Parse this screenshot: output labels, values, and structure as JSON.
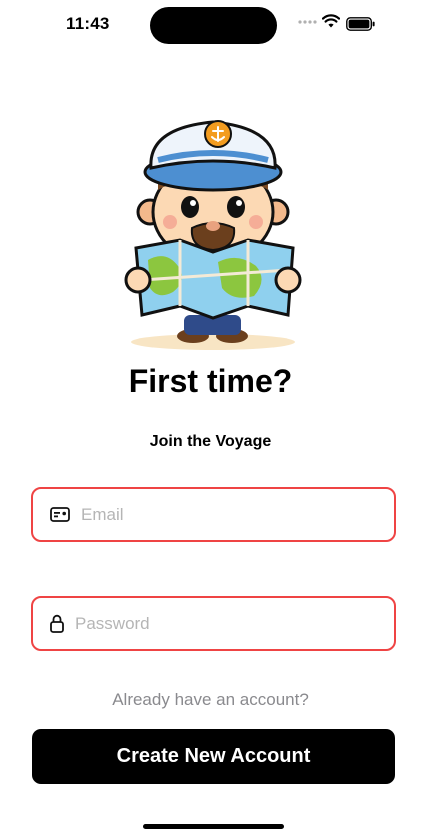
{
  "status_bar": {
    "time": "11:43",
    "signal_icon": "signal-dots-icon",
    "wifi_icon": "wifi-icon",
    "battery_icon": "battery-icon"
  },
  "hero": {
    "image_icon": "sailor-captain-with-map-icon",
    "title": "First time?",
    "subtitle": "Join the Voyage"
  },
  "form": {
    "email": {
      "placeholder": "Email",
      "value": "",
      "icon": "id-card-icon"
    },
    "password": {
      "placeholder": "Password",
      "value": "",
      "icon": "lock-icon"
    },
    "field_border_color": "#ef4444"
  },
  "login_link": "Already have an account?",
  "primary_button": {
    "label": "Create New Account",
    "color": "#000000"
  }
}
